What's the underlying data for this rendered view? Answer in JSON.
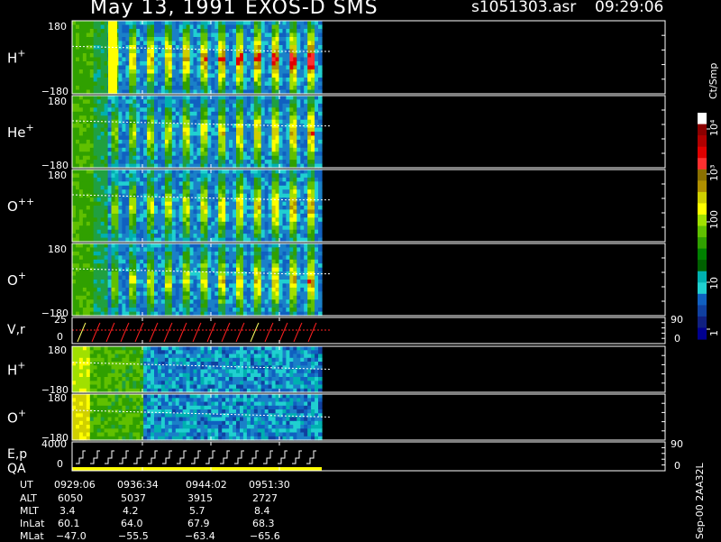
{
  "header": {
    "date": "May 13, 1991",
    "instrument": "EXOS-D SMS",
    "filename": "s1051303.asr",
    "time": "09:29:06"
  },
  "chart_data": {
    "type": "heatmap",
    "colors": {
      "background": "#000000",
      "axis": "#ffffff",
      "trace_white": "#ffffff",
      "trace_red": "#ff2020",
      "trace_yellow": "#ffff60",
      "qa_bar": "#ffff00"
    },
    "panels": [
      {
        "id": "H+",
        "label": "H",
        "sup": "+",
        "ytop": "180",
        "ybot": "−180",
        "intensity": 1.25,
        "tint": "rich"
      },
      {
        "id": "He+",
        "label": "He",
        "sup": "+",
        "ytop": "180",
        "ybot": "−180",
        "intensity": 1.0,
        "tint": "normal"
      },
      {
        "id": "O++",
        "label": "O",
        "sup": "++",
        "ytop": "180",
        "ybot": "",
        "intensity": 1.0,
        "tint": "normal"
      },
      {
        "id": "O+",
        "label": "O",
        "sup": "+",
        "ytop": "180",
        "ybot": "−180",
        "intensity": 1.0,
        "tint": "normal"
      }
    ],
    "lower_panels": [
      {
        "id": "H+b",
        "label": "H",
        "sup": "+",
        "ytop": "180",
        "ybot": "−180"
      },
      {
        "id": "O+b",
        "label": "O",
        "sup": "+",
        "ytop": "180",
        "ybot": "−180"
      }
    ],
    "line_panels": [
      {
        "id": "Vr",
        "label": "V,r",
        "ytop": "25",
        "ybot": "0",
        "right_top": "90",
        "right_bot": "0"
      },
      {
        "id": "Ep",
        "label": "E,p",
        "label2": "QA",
        "ytop": "4000",
        "ybot": "0",
        "right_top": "90",
        "right_bot": "0"
      }
    ],
    "colorbar": {
      "unit": "Ct/Smp",
      "tick_labels": [
        "10⁴",
        "10³",
        "100",
        "10",
        "1"
      ],
      "colors": [
        "#ffffff",
        "#8b0000",
        "#b00000",
        "#e00000",
        "#ff3030",
        "#8b7000",
        "#b09000",
        "#d0d000",
        "#ffff00",
        "#a0e000",
        "#60c000",
        "#30a000",
        "#008000",
        "#006000",
        "#00b0b0",
        "#20d0d0",
        "#1060c0",
        "#1040a0",
        "#102080",
        "#000090"
      ]
    },
    "footer": {
      "row_labels": [
        "UT",
        "ALT",
        "MLT",
        "InLat",
        "MLat"
      ],
      "columns": [
        [
          "0929:06",
          "6050",
          "3.4",
          "60.1",
          "−47.0"
        ],
        [
          "0936:34",
          "5037",
          "4.2",
          "64.0",
          "−55.5"
        ],
        [
          "0944:02",
          "3915",
          "5.7",
          "67.9",
          "−63.4"
        ],
        [
          "0951:30",
          "2727",
          "8.4",
          "68.3",
          "−65.6"
        ]
      ]
    },
    "side_label": "Sep-00  2AA32L"
  }
}
